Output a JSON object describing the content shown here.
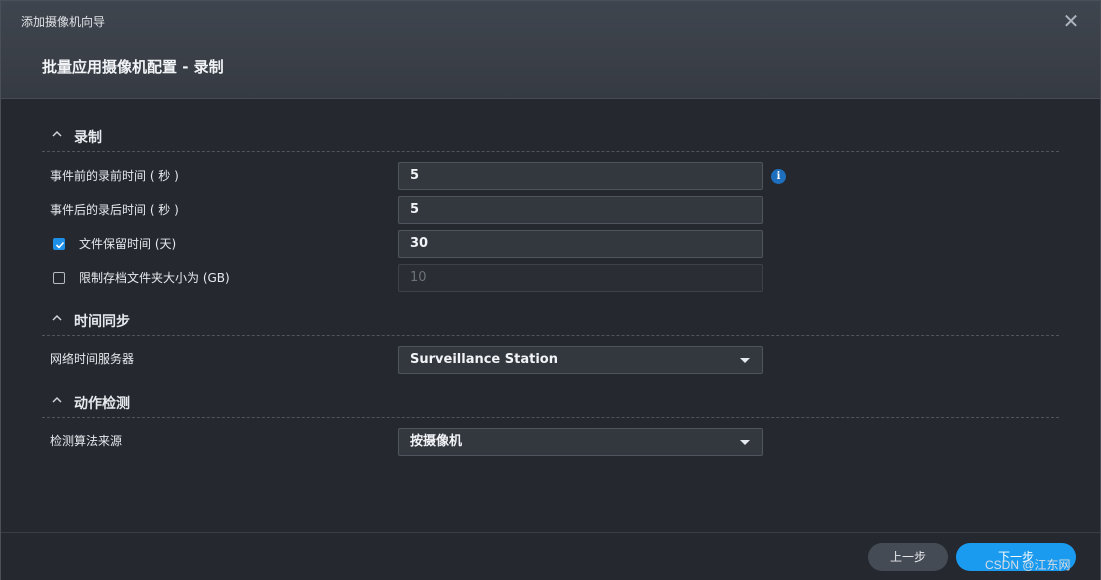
{
  "window": {
    "title": "添加摄像机向导",
    "close_icon": "close-icon"
  },
  "page": {
    "title": "批量应用摄像机配置 - 录制"
  },
  "sections": {
    "recording": {
      "title": "录制",
      "fields": {
        "pre_record": {
          "label": "事件前的录前时间 ( 秒 )",
          "value": "5"
        },
        "post_record": {
          "label": "事件后的录后时间 ( 秒 )",
          "value": "5"
        },
        "retention": {
          "label": "文件保留时间 (天)",
          "value": "30",
          "checked": true
        },
        "size_limit": {
          "label": "限制存档文件夹大小为 (GB)",
          "value": "10",
          "checked": false
        }
      }
    },
    "time_sync": {
      "title": "时间同步",
      "ntp": {
        "label": "网络时间服务器",
        "value": "Surveillance Station"
      }
    },
    "motion": {
      "title": "动作检测",
      "algorithm": {
        "label": "检测算法来源",
        "value": "按摄像机"
      }
    }
  },
  "footer": {
    "prev_label": "上一步",
    "next_label": "下一步"
  },
  "watermark": "CSDN @江东网",
  "colors": {
    "accent": "#1a9bf0",
    "background": "#25282e",
    "header": "#3a3f47"
  }
}
